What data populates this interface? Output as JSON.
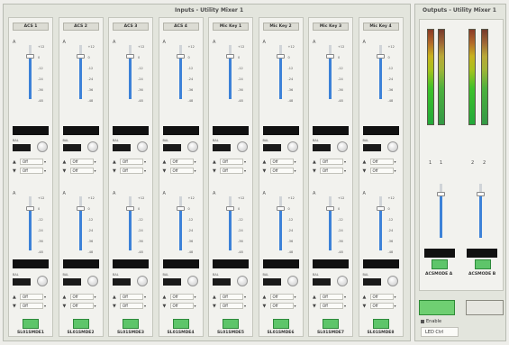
{
  "inputs_panel": {
    "title": "Inputs - Utility Mixer 1"
  },
  "outputs_panel": {
    "title": "Outputs - Utility Mixer 1",
    "channels": [
      {
        "number": "1",
        "name": "ACSMODE A"
      },
      {
        "number": "2",
        "name": "ACSMODE B"
      }
    ],
    "button_left": "",
    "button_right": "",
    "enable_label": "Enable",
    "field_value": "LED Ctrl"
  },
  "fader_scale": [
    "+12",
    "0",
    "-12",
    "-24",
    "-36",
    "-48"
  ],
  "fader_glyph": "A",
  "balance_label": "BAL",
  "route_up_arrow": "▲",
  "route_down_arrow": "▼",
  "route_dropdown": "▾",
  "strips": [
    {
      "label": "ACS 1",
      "name": "SL01SMDE1",
      "route1": "Off",
      "route2": "Off",
      "route3": "Off",
      "route4": "Off",
      "fader_top": 0.8,
      "fader_bot": 0.78
    },
    {
      "label": "ACS 2",
      "name": "SL01SMDE2",
      "route1": "Off",
      "route2": "Off",
      "route3": "Off",
      "route4": "Off",
      "fader_top": 0.8,
      "fader_bot": 0.78
    },
    {
      "label": "ACS 3",
      "name": "SL01SMDE3",
      "route1": "Off",
      "route2": "Off",
      "route3": "Off",
      "route4": "Off",
      "fader_top": 0.8,
      "fader_bot": 0.78
    },
    {
      "label": "ACS 4",
      "name": "SL01SMDE4",
      "route1": "Off",
      "route2": "Off",
      "route3": "Off",
      "route4": "Off",
      "fader_top": 0.8,
      "fader_bot": 0.78
    },
    {
      "label": "Mic Key 1",
      "name": "SL01SMDE5",
      "route1": "Off",
      "route2": "Off",
      "route3": "Off",
      "route4": "Off",
      "fader_top": 0.8,
      "fader_bot": 0.78
    },
    {
      "label": "Mic Key 2",
      "name": "SL01SMDE6",
      "route1": "Off",
      "route2": "Off",
      "route3": "Off",
      "route4": "Off",
      "fader_top": 0.8,
      "fader_bot": 0.78
    },
    {
      "label": "Mic Key 3",
      "name": "SL01SMDE7",
      "route1": "Off",
      "route2": "Off",
      "route3": "Off",
      "route4": "Off",
      "fader_top": 0.8,
      "fader_bot": 0.78
    },
    {
      "label": "Mic Key 4",
      "name": "SL01SMDE8",
      "route1": "Off",
      "route2": "Off",
      "route3": "Off",
      "route4": "Off",
      "fader_top": 0.8,
      "fader_bot": 0.78
    }
  ],
  "output_fader_level": 0.82
}
